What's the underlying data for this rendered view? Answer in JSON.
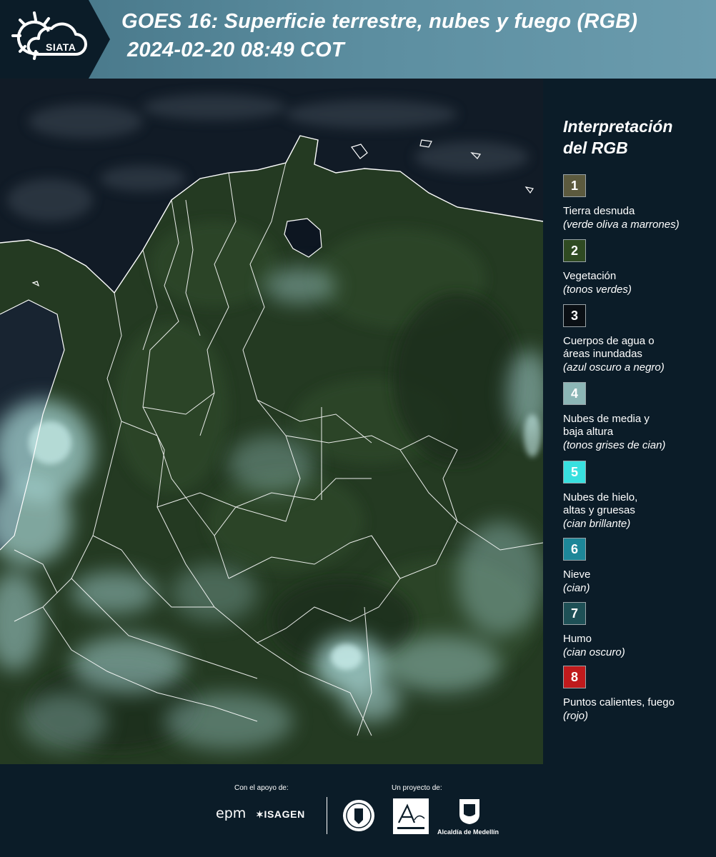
{
  "header": {
    "logo_text": "SIATA",
    "title": "GOES 16: Superficie terrestre, nubes y fuego (RGB)",
    "subtitle": "2024-02-20 08:49 COT"
  },
  "legend": {
    "title_line1": "Interpretación",
    "title_line2": "del RGB",
    "items": [
      {
        "num": "1",
        "color": "#5c5a3e",
        "label": "Tierra desnuda",
        "desc": "(verde oliva a marrones)"
      },
      {
        "num": "2",
        "color": "#2f4a22",
        "label": "Vegetación",
        "desc": "(tonos verdes)"
      },
      {
        "num": "3",
        "color": "#0a0f14",
        "label": "Cuerpos de agua o áreas inundadas",
        "desc": "(azul oscuro a negro)"
      },
      {
        "num": "4",
        "color": "#8cb6b6",
        "label": "Nubes de media y baja altura",
        "desc": "(tonos grises de cian)"
      },
      {
        "num": "5",
        "color": "#38e0df",
        "label": "Nubes de hielo, altas y gruesas",
        "desc": "(cian brillante)"
      },
      {
        "num": "6",
        "color": "#1d8799",
        "label": "Nieve",
        "desc": "(cian)"
      },
      {
        "num": "7",
        "color": "#1e5056",
        "label": "Humo",
        "desc": "(cian oscuro)"
      },
      {
        "num": "8",
        "color": "#c01a1c",
        "label": "Puntos calientes, fuego",
        "desc": "(rojo)"
      }
    ]
  },
  "footer": {
    "support_label": "Con el apoyo de:",
    "project_label": "Un proyecto de:",
    "sponsor1": "epm",
    "sponsor2": "ISAGEN",
    "partner_label": "Alcaldía de Medellín"
  },
  "colors": {
    "background": "#0b1c28",
    "header_band": "#5c8ea0",
    "ocean": "#0f1a26",
    "land": "#253a22",
    "cloud": "#9cc9c8",
    "border": "#ffffff"
  }
}
